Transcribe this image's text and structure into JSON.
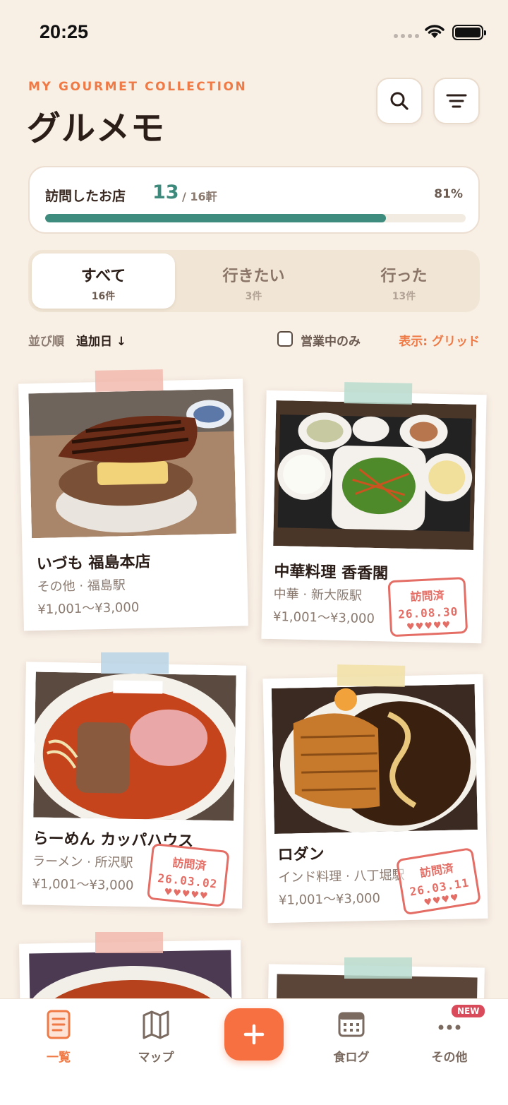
{
  "status": {
    "time": "20:25"
  },
  "header": {
    "subtitle": "MY GOURMET COLLECTION",
    "title": "グルメモ"
  },
  "progress": {
    "label": "訪問したお店",
    "count": "13",
    "total": "/ 16軒",
    "percent_text": "81%",
    "fraction": 0.81
  },
  "tabs": [
    {
      "label": "すべて",
      "count": "16件"
    },
    {
      "label": "行きたい",
      "count": "3件"
    },
    {
      "label": "行った",
      "count": "13件"
    }
  ],
  "filters": {
    "sort_label": "並び順",
    "sort_value": "追加日 ↓",
    "open_only": "営業中のみ",
    "view": "表示: グリッド"
  },
  "cards": [
    {
      "name": "いづも 福島本店",
      "meta": "その他 · 福島駅",
      "price": "¥1,001～¥3,000"
    },
    {
      "name": "中華料理 香香閣",
      "meta": "中華 · 新大阪駅",
      "price": "¥1,001～¥3,000",
      "stamp": {
        "label": "訪問済",
        "date": "26.08.30",
        "hearts": "♥♥♥♥♥"
      }
    },
    {
      "name": "らーめん カッパハウス",
      "meta": "ラーメン · 所沢駅",
      "price": "¥1,001～¥3,000",
      "stamp": {
        "label": "訪問済",
        "date": "26.03.02",
        "hearts": "♥♥♥♥♥"
      }
    },
    {
      "name": "ロダン",
      "meta": "インド料理 · 八丁堀駅",
      "price": "¥1,001～¥3,000",
      "stamp": {
        "label": "訪問済",
        "date": "26.03.11",
        "hearts": "♥♥♥♥"
      }
    }
  ],
  "nav": {
    "list": "一覧",
    "map": "マップ",
    "log": "食ログ",
    "more": "その他",
    "badge": "NEW"
  },
  "colors": {
    "accent": "#f07a45",
    "progress": "#3e8c7d",
    "stamp": "#e46e65",
    "background": "#f8efe5"
  }
}
